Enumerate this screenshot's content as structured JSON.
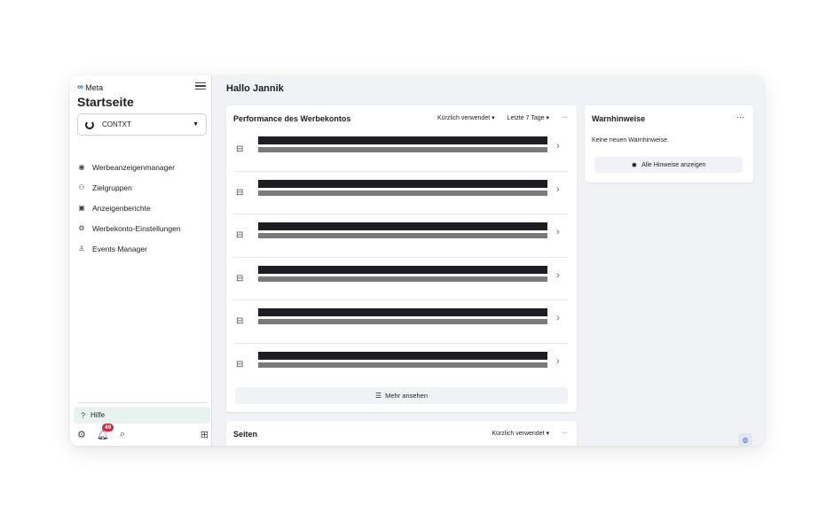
{
  "sidebar": {
    "brand": "Meta",
    "title": "Startseite",
    "account": "CONTXT",
    "nav": [
      {
        "label": "Werbeanzeigenmanager",
        "icon": "ads-manager-icon"
      },
      {
        "label": "Zielgruppen",
        "icon": "audiences-icon"
      },
      {
        "label": "Anzeigenberichte",
        "icon": "reports-icon"
      },
      {
        "label": "Werbekonto-Einstellungen",
        "icon": "ad-account-settings-icon"
      },
      {
        "label": "Events Manager",
        "icon": "events-manager-icon"
      }
    ],
    "help": "Hilfe",
    "notification_count": "49"
  },
  "main": {
    "greeting": "Hallo Jannik",
    "performance": {
      "title": "Performance des Werbekontos",
      "filter_recent": "Kürzlich verwendet",
      "filter_range": "Letzte 7 Tage",
      "more": "Mehr ansehen",
      "row_count": 6
    },
    "warnings": {
      "title": "Warnhinweise",
      "empty": "Keine neuen Warnhinweise.",
      "button": "Alle Hinweise anzeigen"
    },
    "pages": {
      "title": "Seiten",
      "filter_recent": "Kürzlich verwendet"
    }
  }
}
